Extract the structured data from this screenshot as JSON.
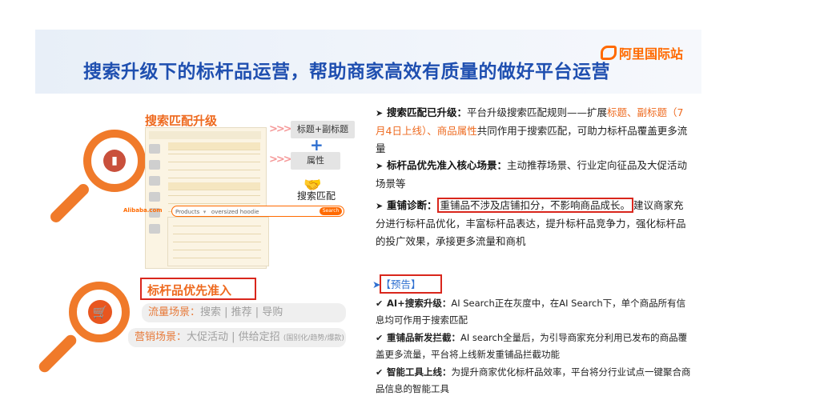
{
  "header": {
    "title": "搜索升级下的标杆品运营，帮助商家高效有质量的做好平台运营",
    "brand": "阿里国际站",
    "brand_color": "#ff6a00",
    "title_color": "#1f4fb0"
  },
  "left": {
    "search_upgrade_label": "搜索匹配升级",
    "pill_title": "标题+副标题",
    "pill_attr": "属性",
    "match_label": "搜索匹配",
    "search_placeholder": "oversized hoodie",
    "search_button": "Search",
    "search_category": "Products",
    "alibaba_logo": "Alibaba.com",
    "benchmark_label": "标杆品优先准入",
    "traffic_prefix": "流量场景：",
    "traffic_items": "搜索 | 推荐 | 导购",
    "marketing_prefix": "营销场景：",
    "marketing_items": "大促活动 | 供给定招",
    "marketing_note": "(国别化/趋势/爆款)",
    "accent_color": "#ee6a1f",
    "highlight_box_color": "#d9261c"
  },
  "right": {
    "p1_head": "搜索匹配已升级：",
    "p1_text_a": "平台升级搜索匹配规则——扩展",
    "p1_hl_a": "标题、副标题（7月4日上线）、商品属性",
    "p1_text_b": "共同作用于搜索匹配，可助力标杆品覆盖更多流量",
    "p2_head": "标杆品优先准入核心场景：",
    "p2_text": "主动推荐场景、行业定向征品及大促活动场景等",
    "p3_head": "重铺诊断：",
    "p3_boxed": "重铺品不涉及店铺扣分，不影响商品成长。",
    "p3_text": "建议商家充分进行标杆品优化，丰富标杆品表达，提升标杆品竞争力，强化标杆品的投广效果，承接更多流量和商机",
    "notice": "【预告】",
    "items": [
      {
        "head": "AI+搜索升级：",
        "text": "AI Search正在灰度中，在AI Search下，单个商品所有信息均可作用于搜索匹配"
      },
      {
        "head": "重铺品新发拦截：",
        "text": "AI search全量后，为引导商家充分利用已发布的商品覆盖更多流量，平台将上线新发重铺品拦截功能"
      },
      {
        "head": "智能工具上线：",
        "text": "为提升商家优化标杆品效率，平台将分行业试点一键聚合商品信息的智能工具"
      }
    ]
  }
}
